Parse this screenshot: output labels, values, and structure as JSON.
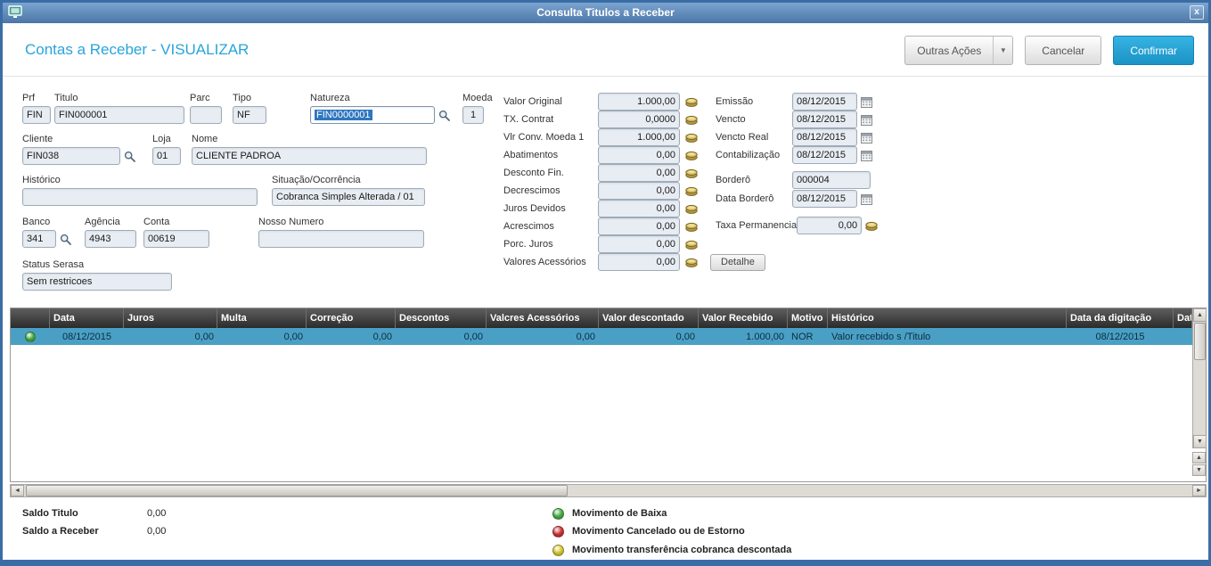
{
  "window": {
    "title": "Consulta Titulos a Receber",
    "close_label": "x"
  },
  "header": {
    "title": "Contas a Receber - VISUALIZAR",
    "outras_acoes": "Outras Ações",
    "outras_acoes_arrow": "▼",
    "cancelar": "Cancelar",
    "confirmar": "Confirmar"
  },
  "form": {
    "prf_label": "Prf",
    "prf": "FIN",
    "titulo_label": "Titulo",
    "titulo": "FIN000001",
    "parc_label": "Parc",
    "parc": "",
    "tipo_label": "Tipo",
    "tipo": "NF",
    "natureza_label": "Natureza",
    "natureza": "FIN0000001",
    "moeda_label": "Moeda",
    "moeda": "1",
    "cliente_label": "Cliente",
    "cliente": "FIN038",
    "loja_label": "Loja",
    "loja": "01",
    "nome_label": "Nome",
    "nome": "CLIENTE PADROA",
    "historico_label": "Histórico",
    "historico": "",
    "situacao_label": "Situação/Ocorrência",
    "situacao": "Cobranca Simples Alterada / 01",
    "banco_label": "Banco",
    "banco": "341",
    "agencia_label": "Agência",
    "agencia": "4943",
    "conta_label": "Conta",
    "conta": "00619",
    "nosso_numero_label": "Nosso Numero",
    "nosso_numero": "",
    "status_serasa_label": "Status Serasa",
    "status_serasa": "Sem restricoes"
  },
  "valores": {
    "rows": [
      {
        "label": "Valor Original",
        "value": "1.000,00"
      },
      {
        "label": "TX. Contrat",
        "value": "0,0000"
      },
      {
        "label": "Vlr Conv. Moeda 1",
        "value": "1.000,00"
      },
      {
        "label": "Abatimentos",
        "value": "0,00"
      },
      {
        "label": "Desconto Fin.",
        "value": "0,00"
      },
      {
        "label": "Decrescimos",
        "value": "0,00"
      },
      {
        "label": "Juros Devidos",
        "value": "0,00"
      },
      {
        "label": "Acrescimos",
        "value": "0,00"
      },
      {
        "label": "Porc. Juros",
        "value": "0,00"
      },
      {
        "label": "Valores Acessórios",
        "value": "0,00"
      }
    ],
    "detalhe": "Detalhe"
  },
  "datas": {
    "emissao_label": "Emissão",
    "emissao": "08/12/2015",
    "vencto_label": "Vencto",
    "vencto": "08/12/2015",
    "vencto_real_label": "Vencto Real",
    "vencto_real": "08/12/2015",
    "contabilizacao_label": "Contabilização",
    "contabilizacao": "08/12/2015",
    "bordero_label": "Borderô",
    "bordero": "000004",
    "data_bordero_label": "Data Borderô",
    "data_bordero": "08/12/2015",
    "taxa_permanencia_label": "Taxa Permanencia",
    "taxa_permanencia": "0,00"
  },
  "grid": {
    "columns": [
      "",
      "Data",
      "Juros",
      "Multa",
      "Correção",
      "Descontos",
      "Valcres Acessórios",
      "Valor descontado",
      "Valor Recebido",
      "Motivo",
      "Histórico",
      "Data da digitação",
      "Dat"
    ],
    "row": {
      "status_color": "#4db848",
      "data": "08/12/2015",
      "juros": "0,00",
      "multa": "0,00",
      "correcao": "0,00",
      "descontos": "0,00",
      "valores_acessorios": "0,00",
      "valor_descontado": "0,00",
      "valor_recebido": "1.000,00",
      "motivo": "NOR",
      "historico": "Valor recebido s /Titulo",
      "data_digitacao": "08/12/2015"
    }
  },
  "footer": {
    "saldo_titulo_label": "Saldo Titulo",
    "saldo_titulo": "0,00",
    "saldo_receber_label": "Saldo a Receber",
    "saldo_receber": "0,00",
    "legend": [
      {
        "label": "Movimento de Baixa",
        "color": "#4db848"
      },
      {
        "label": "Movimento Cancelado ou de Estorno",
        "color": "#d9363b"
      },
      {
        "label": "Movimento transferência cobranca descontada",
        "color": "#e0d63a"
      }
    ]
  },
  "colors": {
    "window_border": "#3a6da6",
    "accent_blue": "#27a5da",
    "confirm_button": "#1a92c5",
    "grid_header": "#2b2b2b",
    "selected_row": "#4aa0c4"
  }
}
